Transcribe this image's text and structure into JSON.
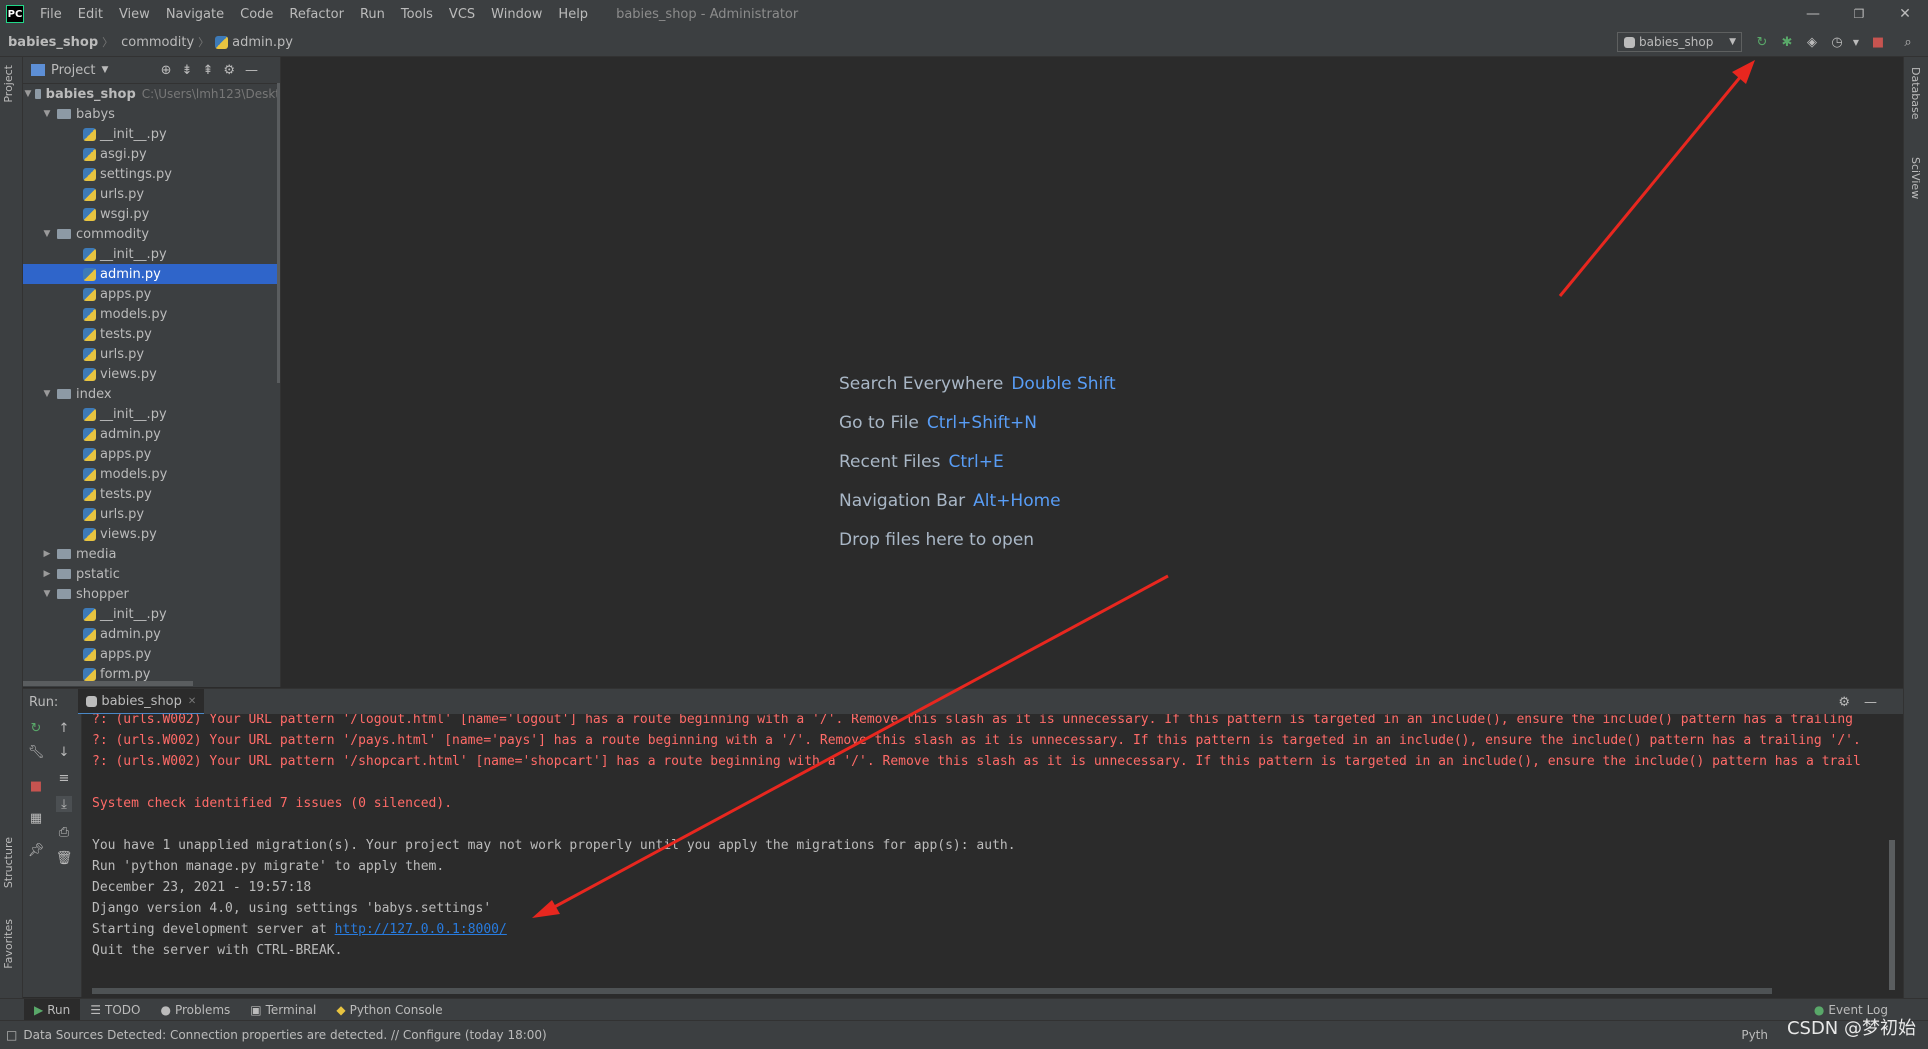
{
  "titlebar": {
    "menu": [
      "File",
      "Edit",
      "View",
      "Navigate",
      "Code",
      "Refactor",
      "Run",
      "Tools",
      "VCS",
      "Window",
      "Help"
    ],
    "title": "babies_shop - Administrator",
    "minimize": "—",
    "maximize": "❐",
    "close": "✕"
  },
  "navbar": {
    "crumbs": [
      "babies_shop",
      "commodity",
      "admin.py"
    ],
    "run_config": "babies_shop"
  },
  "strips": {
    "left": [
      "Project",
      "Structure",
      "Favorites"
    ],
    "right": [
      "Database",
      "SciView"
    ]
  },
  "project": {
    "header": "Project",
    "tree": [
      {
        "label": "babies_shop",
        "type": "root",
        "path": "C:\\Users\\lmh123\\Deskt"
      },
      {
        "label": "babys",
        "type": "folder"
      },
      {
        "label": "__init__.py",
        "type": "file"
      },
      {
        "label": "asgi.py",
        "type": "file"
      },
      {
        "label": "settings.py",
        "type": "file"
      },
      {
        "label": "urls.py",
        "type": "file"
      },
      {
        "label": "wsgi.py",
        "type": "file"
      },
      {
        "label": "commodity",
        "type": "folder"
      },
      {
        "label": "__init__.py",
        "type": "file"
      },
      {
        "label": "admin.py",
        "type": "file",
        "selected": true
      },
      {
        "label": "apps.py",
        "type": "file"
      },
      {
        "label": "models.py",
        "type": "file"
      },
      {
        "label": "tests.py",
        "type": "file"
      },
      {
        "label": "urls.py",
        "type": "file"
      },
      {
        "label": "views.py",
        "type": "file"
      },
      {
        "label": "index",
        "type": "folder"
      },
      {
        "label": "__init__.py",
        "type": "file"
      },
      {
        "label": "admin.py",
        "type": "file"
      },
      {
        "label": "apps.py",
        "type": "file"
      },
      {
        "label": "models.py",
        "type": "file"
      },
      {
        "label": "tests.py",
        "type": "file"
      },
      {
        "label": "urls.py",
        "type": "file"
      },
      {
        "label": "views.py",
        "type": "file"
      },
      {
        "label": "media",
        "type": "folder-collapsed"
      },
      {
        "label": "pstatic",
        "type": "folder-collapsed"
      },
      {
        "label": "shopper",
        "type": "folder"
      },
      {
        "label": "__init__.py",
        "type": "file"
      },
      {
        "label": "admin.py",
        "type": "file"
      },
      {
        "label": "apps.py",
        "type": "file"
      },
      {
        "label": "form.py",
        "type": "file"
      }
    ]
  },
  "editor": {
    "hints": [
      {
        "label": "Search Everywhere",
        "key": "Double Shift"
      },
      {
        "label": "Go to File",
        "key": "Ctrl+Shift+N"
      },
      {
        "label": "Recent Files",
        "key": "Ctrl+E"
      },
      {
        "label": "Navigation Bar",
        "key": "Alt+Home"
      },
      {
        "label": "Drop files here to open",
        "key": ""
      }
    ]
  },
  "run": {
    "label": "Run:",
    "tab": "babies_shop",
    "lines": [
      {
        "text": "?: (urls.W002) Your URL pattern '/logout.html' [name='logout'] has a route beginning with a '/'. Remove this slash as it is unnecessary. If this pattern is targeted in an include(), ensure the include() pattern has a trailing",
        "kind": "err"
      },
      {
        "text": "?: (urls.W002) Your URL pattern '/pays.html' [name='pays'] has a route beginning with a '/'. Remove this slash as it is unnecessary. If this pattern is targeted in an include(), ensure the include() pattern has a trailing '/'.",
        "kind": "err"
      },
      {
        "text": "?: (urls.W002) Your URL pattern '/shopcart.html' [name='shopcart'] has a route beginning with a '/'. Remove this slash as it is unnecessary. If this pattern is targeted in an include(), ensure the include() pattern has a trail",
        "kind": "err"
      },
      {
        "text": "",
        "kind": "out"
      },
      {
        "text": "System check identified 7 issues (0 silenced).",
        "kind": "err"
      },
      {
        "text": "",
        "kind": "out"
      },
      {
        "text": "You have 1 unapplied migration(s). Your project may not work properly until you apply the migrations for app(s): auth.",
        "kind": "out"
      },
      {
        "text": "Run 'python manage.py migrate' to apply them.",
        "kind": "out"
      },
      {
        "text": "December 23, 2021 - 19:57:18",
        "kind": "out"
      },
      {
        "text": "Django version 4.0, using settings 'babys.settings'",
        "kind": "out"
      },
      {
        "text": "Starting development server at ",
        "kind": "out",
        "link": "http://127.0.0.1:8000/"
      },
      {
        "text": "Quit the server with CTRL-BREAK.",
        "kind": "out"
      }
    ]
  },
  "bottom_tabs": [
    "Run",
    "TODO",
    "Problems",
    "Terminal",
    "Python Console"
  ],
  "event_log": "Event Log",
  "status": {
    "message": "Data Sources Detected: Connection properties are detected. // Configure (today 18:00)",
    "right": "Pyth",
    "watermark": "CSDN @梦初始"
  },
  "colors": {
    "accent": "#2f65ca",
    "error": "#ff6b68",
    "link": "#287bde",
    "hint_key": "#589df6",
    "annotation_arrow": "#e8271f"
  }
}
